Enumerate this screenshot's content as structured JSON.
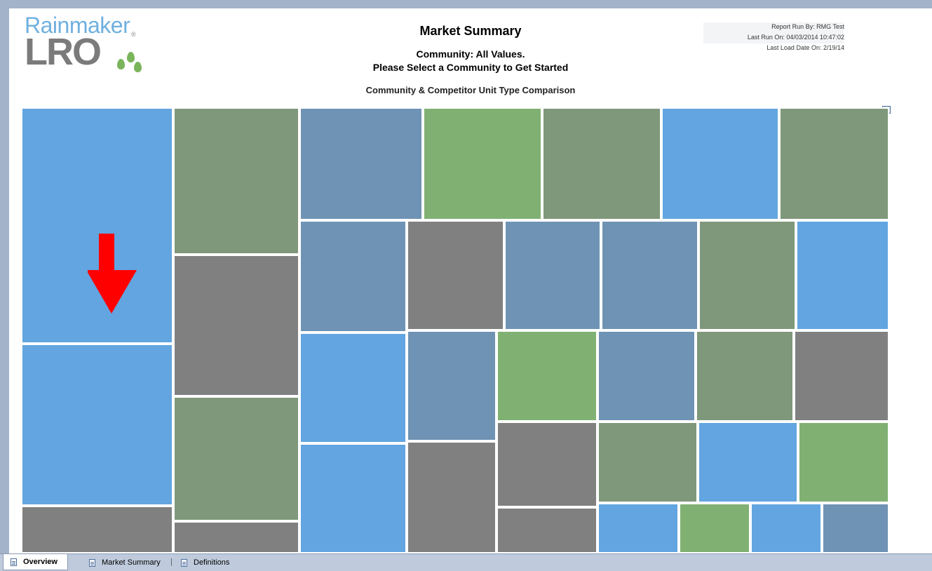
{
  "logo": {
    "word": "Rainmaker",
    "lro": "LRO",
    "reg": "®"
  },
  "report": {
    "title": "Market Summary",
    "community": "Community: All Values.",
    "prompt": "Please Select a Community to Get Started",
    "section_title": "Community & Competitor Unit Type Comparison"
  },
  "run_info": {
    "run_by": "Report Run By:  RMG Test",
    "last_run": "Last Run On: 04/03/2014 10:47:02",
    "last_load": "Last Load Date On: 2/19/14"
  },
  "treemap_tiles": [
    {
      "label": "",
      "color": "#62a5e0"
    },
    {
      "label": "",
      "color": "#62a5e0"
    },
    {
      "label": "",
      "color": "#808080"
    },
    {
      "label": "",
      "color": "#7f977a"
    },
    {
      "label": "",
      "color": "#808080"
    },
    {
      "label": "",
      "color": "#7f977a"
    },
    {
      "label": "",
      "color": "#808080"
    },
    {
      "label": "",
      "color": "#6f93b4"
    },
    {
      "label": "",
      "color": "#80b173"
    },
    {
      "label": "",
      "color": "#7f977a"
    },
    {
      "label": "",
      "color": "#62a5e0"
    },
    {
      "label": "",
      "color": "#7f977a"
    },
    {
      "label": "",
      "color": "#6f93b4"
    },
    {
      "label": "",
      "color": "#808080"
    },
    {
      "label": "",
      "color": "#6f93b4"
    },
    {
      "label": "",
      "color": "#6f93b4"
    },
    {
      "label": "",
      "color": "#7f977a"
    },
    {
      "label": "",
      "color": "#62a5e0"
    },
    {
      "label": "",
      "color": "#62a5e0"
    },
    {
      "label": "",
      "color": "#6f93b4"
    },
    {
      "label": "",
      "color": "#80b173"
    },
    {
      "label": "",
      "color": "#6f93b4"
    },
    {
      "label": "",
      "color": "#7f977a"
    },
    {
      "label": "",
      "color": "#808080"
    },
    {
      "label": "",
      "color": "#62a5e0"
    },
    {
      "label": "",
      "color": "#808080"
    },
    {
      "label": "",
      "color": "#808080"
    },
    {
      "label": "",
      "color": "#7f977a"
    },
    {
      "label": "",
      "color": "#62a5e0"
    },
    {
      "label": "",
      "color": "#80b173"
    },
    {
      "label": "",
      "color": "#808080"
    },
    {
      "label": "",
      "color": "#62a5e0"
    },
    {
      "label": "",
      "color": "#80b173"
    },
    {
      "label": "",
      "color": "#62a5e0"
    },
    {
      "label": "",
      "color": "#6f93b4"
    }
  ],
  "annotation": {
    "arrow_color": "#ff0000"
  },
  "tabs": {
    "overview": "Overview",
    "market_summary": "Market Summary",
    "separator": "|",
    "definitions": "Definitions"
  }
}
